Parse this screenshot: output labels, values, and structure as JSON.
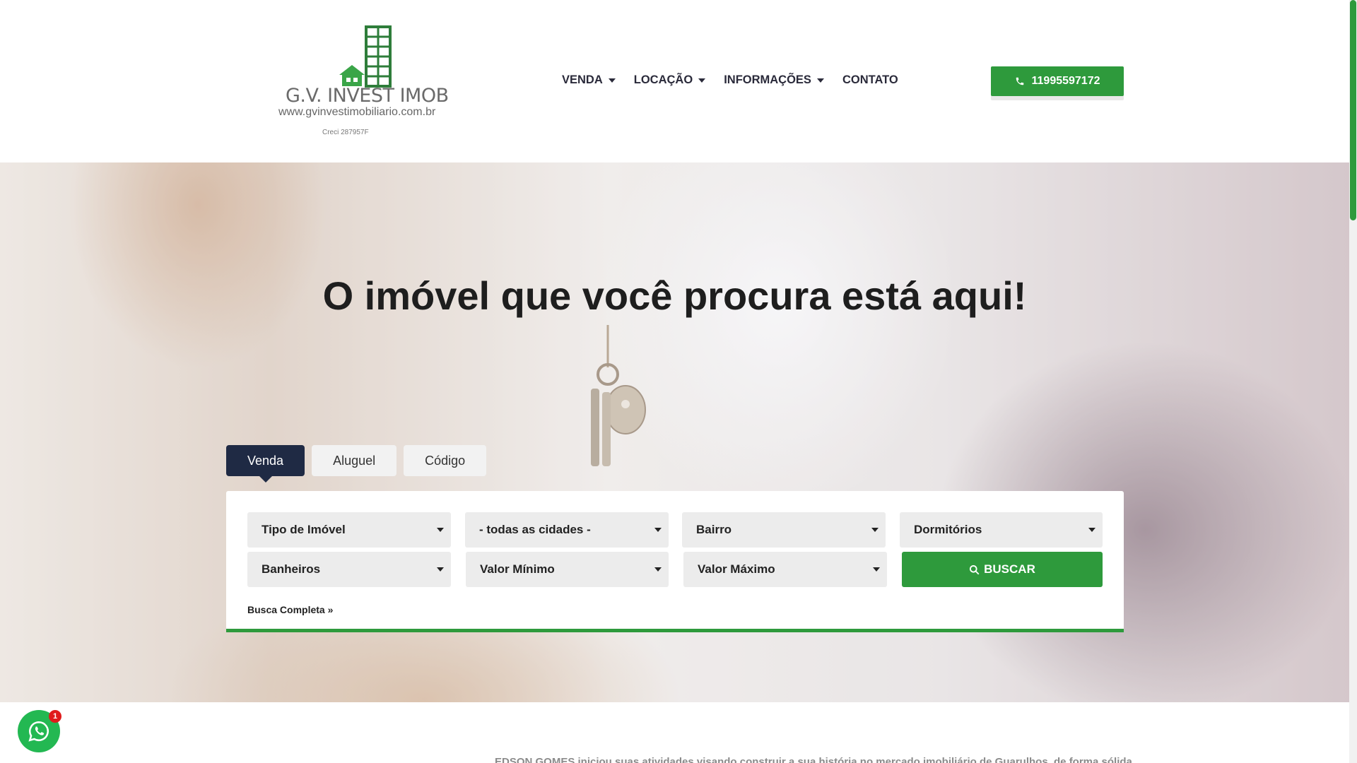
{
  "header": {
    "logo": {
      "name": "G.V. INVEST IMOB",
      "url": "www.gvinvestimobiliario.com.br",
      "creci": "Creci 287957F"
    },
    "nav": [
      {
        "label": "VENDA",
        "has_dropdown": true
      },
      {
        "label": "LOCAÇÃO",
        "has_dropdown": true
      },
      {
        "label": "INFORMAÇÕES",
        "has_dropdown": true
      },
      {
        "label": "CONTATO",
        "has_dropdown": false
      }
    ],
    "phone": "11995597172",
    "phone_icon": "phone-icon"
  },
  "hero": {
    "title": "O imóvel que você procura está aqui!"
  },
  "search": {
    "tabs": [
      {
        "label": "Venda",
        "active": true
      },
      {
        "label": "Aluguel",
        "active": false
      },
      {
        "label": "Código",
        "active": false
      }
    ],
    "fields": {
      "tipo": "Tipo de Imóvel",
      "cidade": "- todas as cidades -",
      "bairro": "Bairro",
      "dormitorios": "Dormitórios",
      "banheiros": "Banheiros",
      "valor_min": "Valor Mínimo",
      "valor_max": "Valor Máximo"
    },
    "buscar_label": "BUSCAR",
    "busca_completa": "Busca Completa »"
  },
  "intro": "EDSON GOMES iniciou suas atividades visando construir a sua história no mercado imobiliário de Guarulhos, de forma sólida",
  "whatsapp": {
    "badge": "1",
    "icon": "whatsapp-icon"
  },
  "colors": {
    "accent": "#2e9a3c",
    "navy": "#1f2a44"
  }
}
